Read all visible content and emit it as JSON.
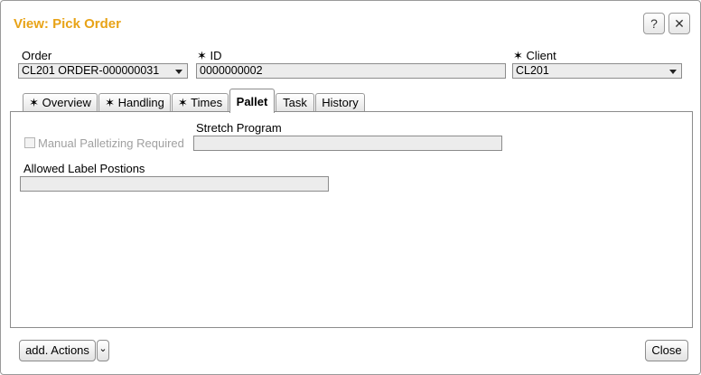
{
  "window": {
    "title": "View: Pick Order",
    "help_label": "?",
    "close_label": "✕"
  },
  "header": {
    "order": {
      "label": "Order",
      "value": "CL201 ORDER-000000031"
    },
    "id": {
      "label": "✶ ID",
      "value": "0000000002"
    },
    "client": {
      "label": "✶ Client",
      "value": "CL201"
    }
  },
  "tabs": [
    {
      "label": "✶ Overview",
      "active": false
    },
    {
      "label": "✶ Handling",
      "active": false
    },
    {
      "label": "✶ Times",
      "active": false
    },
    {
      "label": "Pallet",
      "active": true
    },
    {
      "label": "Task",
      "active": false
    },
    {
      "label": "History",
      "active": false
    }
  ],
  "pallet": {
    "manual_palletizing_label": "Manual Palletizing Required",
    "manual_palletizing_checked": false,
    "stretch_program_label": "Stretch Program",
    "stretch_program_value": "",
    "allowed_label_positions_label": "Allowed Label Postions",
    "allowed_label_positions_value": ""
  },
  "footer": {
    "add_actions_label": "add. Actions",
    "more_label": "⌄",
    "close_label": "Close"
  },
  "colors": {
    "title": "#e8a317",
    "field_bg": "#ececec",
    "disabled_text": "#a0a0a0"
  }
}
